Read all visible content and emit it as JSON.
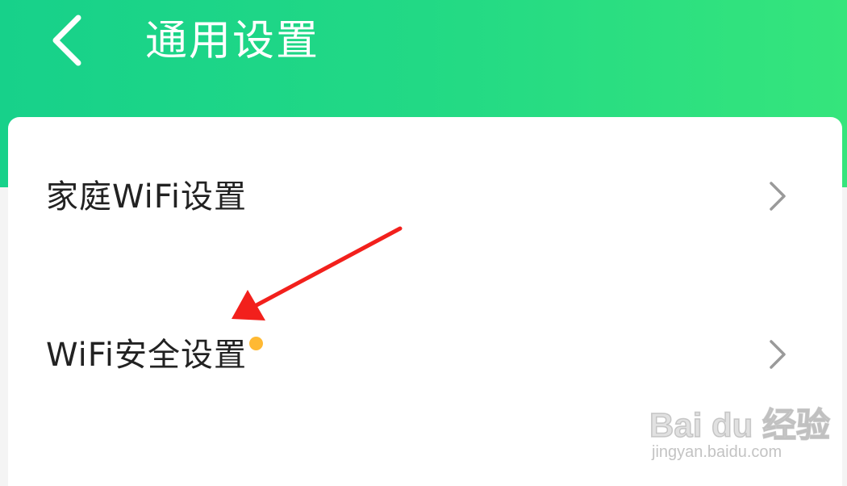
{
  "header": {
    "title": "通用设置",
    "back_icon": "chevron-left-icon",
    "gradient_start": "#17d18a",
    "gradient_end": "#35e57c"
  },
  "settings": {
    "items": [
      {
        "label": "家庭WiFi设置",
        "has_badge": false,
        "icon": "chevron-right-icon"
      },
      {
        "label": "WiFi安全设置",
        "has_badge": true,
        "badge_color": "#ffb933",
        "icon": "chevron-right-icon"
      }
    ]
  },
  "annotation": {
    "arrow_color": "#f2201c",
    "icon": "red-arrow"
  },
  "watermark": {
    "brand": "Bai du 经验",
    "url": "jingyan.baidu.com"
  }
}
